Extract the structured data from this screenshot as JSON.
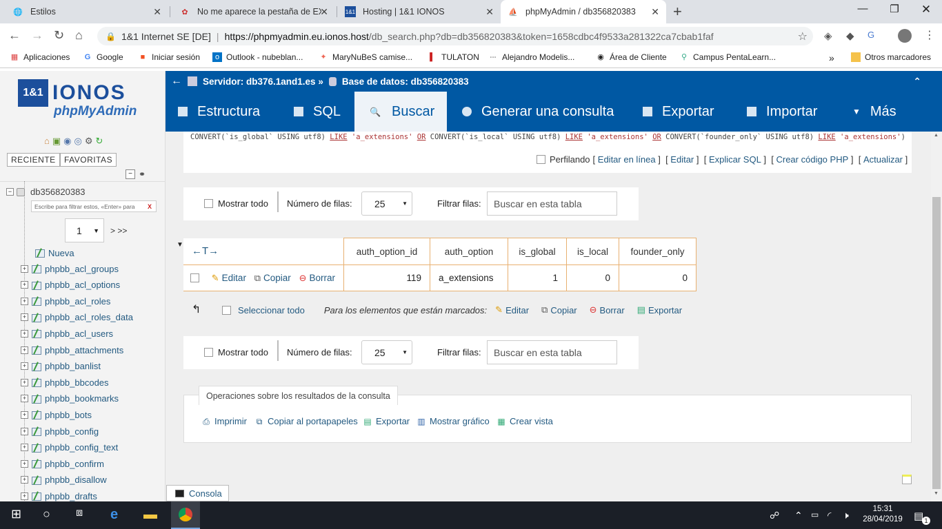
{
  "browser": {
    "tabs": [
      {
        "title": "Estilos",
        "icon": "globe-icon"
      },
      {
        "title": "No me aparece la pestaña de EXT",
        "icon": "forum-icon"
      },
      {
        "title": "Hosting | 1&1 IONOS",
        "icon": "ionos-icon"
      },
      {
        "title": "phpMyAdmin / db356820383",
        "icon": "phpmyadmin-icon"
      }
    ],
    "address": {
      "site_label": "1&1 Internet SE [DE]",
      "url_domain": "https://phpmyadmin.eu.ionos.host",
      "url_path": "/db_search.php?db=db356820383&token=1658cdbc4f9533a281322ca7cbab1faf"
    },
    "bookmarks": [
      {
        "label": "Aplicaciones",
        "icon": "apps-grid-icon"
      },
      {
        "label": "Google",
        "icon": "google-icon"
      },
      {
        "label": "Iniciar sesión",
        "icon": "windows-logo-icon"
      },
      {
        "label": "Outlook - nubeblan...",
        "icon": "outlook-icon"
      },
      {
        "label": "MaryNuBeS camise...",
        "icon": "shop-icon"
      },
      {
        "label": "TULATON",
        "icon": "tulaton-icon"
      },
      {
        "label": "Alejandro Modelis...",
        "icon": "dots-icon"
      },
      {
        "label": "Área de Cliente",
        "icon": "client-icon"
      },
      {
        "label": "Campus PentaLearn...",
        "icon": "campus-icon"
      }
    ],
    "bookmarks_more": "»",
    "other_bookmarks": "Otros marcadores"
  },
  "sidebar": {
    "logo_brand": "1&1 IONOS",
    "logo_product": "phpMyAdmin",
    "buttons": [
      "RECIENTE",
      "FAVORITAS"
    ],
    "db_name": "db356820383",
    "filter_placeholder": "Escribe para filtrar estos, «Enter» para",
    "filter_clear": "X",
    "page_select": "1",
    "page_next": "> >>",
    "new_label": "Nueva",
    "tables": [
      "phpbb_acl_groups",
      "phpbb_acl_options",
      "phpbb_acl_roles",
      "phpbb_acl_roles_data",
      "phpbb_acl_users",
      "phpbb_attachments",
      "phpbb_banlist",
      "phpbb_bbcodes",
      "phpbb_bookmarks",
      "phpbb_bots",
      "phpbb_config",
      "phpbb_config_text",
      "phpbb_confirm",
      "phpbb_disallow",
      "phpbb_drafts"
    ]
  },
  "topbar": {
    "server": "Servidor: db376.1and1.es »",
    "database": "Base de datos: db356820383"
  },
  "menu": [
    {
      "label": "Estructura",
      "active": false
    },
    {
      "label": "SQL",
      "active": false
    },
    {
      "label": "Buscar",
      "active": true
    },
    {
      "label": "Generar una consulta",
      "active": false
    },
    {
      "label": "Exportar",
      "active": false
    },
    {
      "label": "Importar",
      "active": false
    },
    {
      "label": "Más",
      "active": false
    }
  ],
  "sql": {
    "segments": [
      {
        "t": "CONVERT(`is_global` USING utf8) ",
        "c": ""
      },
      {
        "t": "LIKE",
        "c": "kw"
      },
      {
        "t": " ",
        "c": ""
      },
      {
        "t": "'a_extensions'",
        "c": "str"
      },
      {
        "t": " ",
        "c": ""
      },
      {
        "t": "OR",
        "c": "kw"
      },
      {
        "t": " CONVERT(`is_local` USING utf8) ",
        "c": ""
      },
      {
        "t": "LIKE",
        "c": "kw"
      },
      {
        "t": " ",
        "c": ""
      },
      {
        "t": "'a_extensions'",
        "c": "str"
      },
      {
        "t": " ",
        "c": ""
      },
      {
        "t": "OR",
        "c": "kw"
      },
      {
        "t": " CONVERT(`founder_only` USING utf8) ",
        "c": ""
      },
      {
        "t": "LIKE",
        "c": "kw"
      },
      {
        "t": " ",
        "c": ""
      },
      {
        "t": "'a_extensions'",
        "c": "str"
      },
      {
        "t": ")",
        "c": ""
      }
    ],
    "profiling_label": "Perfilando",
    "links": [
      "Editar en línea",
      "Editar",
      "Explicar SQL",
      "Crear código PHP",
      "Actualizar"
    ]
  },
  "nav": {
    "show_all": "Mostrar todo",
    "rows_label": "Número de filas:",
    "rows_value": "25",
    "filter_label": "Filtrar filas:",
    "filter_placeholder": "Buscar en esta tabla"
  },
  "results": {
    "columns": [
      "auth_option_id",
      "auth_option",
      "is_global",
      "is_local",
      "founder_only"
    ],
    "rows": [
      {
        "cells": [
          "119",
          "a_extensions",
          "1",
          "0",
          "0"
        ]
      }
    ],
    "row_actions": [
      "Editar",
      "Copiar",
      "Borrar"
    ]
  },
  "bulk": {
    "select_all": "Seleccionar todo",
    "marked_label": "Para los elementos que están marcados:",
    "actions": [
      "Editar",
      "Copiar",
      "Borrar",
      "Exportar"
    ]
  },
  "operations": {
    "legend": "Operaciones sobre los resultados de la consulta",
    "items": [
      "Imprimir",
      "Copiar al portapapeles",
      "Exportar",
      "Mostrar gráfico",
      "Crear vista"
    ]
  },
  "console_label": "Consola",
  "taskbar": {
    "time": "15:31",
    "date": "28/04/2019",
    "notifications": "1"
  }
}
